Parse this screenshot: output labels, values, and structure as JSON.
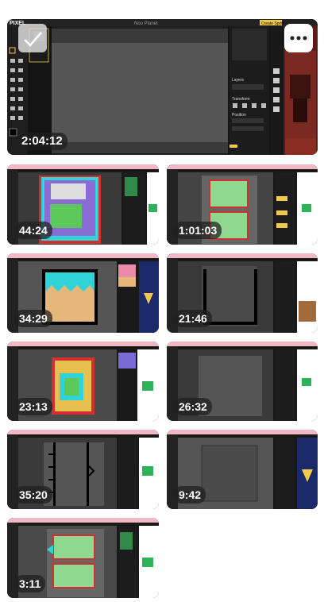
{
  "hero": {
    "app_logo": "PIXEL",
    "window_title": "Noo Planet",
    "create_button": "Create Sprite",
    "panels": {
      "layers": "Layers",
      "transform": "Transform",
      "position": "Position"
    },
    "duration": "2:04:12",
    "check_icon": "checkmark-icon",
    "more_icon": "more-icon"
  },
  "videos": [
    {
      "duration": "44:24"
    },
    {
      "duration": "1:01:03"
    },
    {
      "duration": "34:29"
    },
    {
      "duration": "21:46"
    },
    {
      "duration": "23:13"
    },
    {
      "duration": "26:32"
    },
    {
      "duration": "35:20"
    },
    {
      "duration": "9:42"
    },
    {
      "duration": "3:11"
    }
  ],
  "colors": {
    "browser_bar": "#f2b8c6",
    "editor_bg": "#1d1d1d",
    "canvas_gray": "#555555",
    "accent_yellow": "#f2c94c",
    "accent_green": "#2fb35a"
  }
}
